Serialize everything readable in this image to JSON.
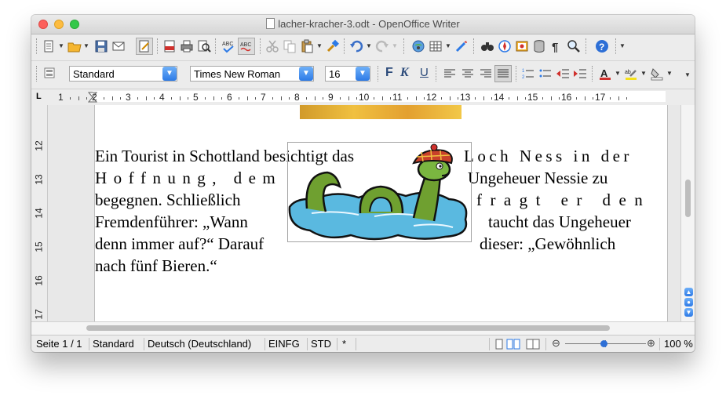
{
  "window": {
    "title": "lacher-kracher-3.odt - OpenOffice Writer"
  },
  "formatting": {
    "paragraph_style": "Standard",
    "font_name": "Times New Roman",
    "font_size": "16",
    "bold_label": "F",
    "italic_label": "K",
    "underline_label": "U"
  },
  "ruler": {
    "horizontal_numbers": [
      "1",
      "2",
      "3",
      "4",
      "5",
      "6",
      "7",
      "8",
      "9",
      "10",
      "11",
      "12",
      "13",
      "14",
      "15",
      "16",
      "17"
    ],
    "vertical_numbers": [
      "12",
      "13",
      "14",
      "15",
      "16",
      "17"
    ]
  },
  "document": {
    "lines": [
      "Ein Tourist in Schottland besichtigt das",
      "Loch Ness in der",
      "H o f f n u n g ,   d e m",
      "Ungeheuer Nessie zu",
      "begegnen. Schließlich",
      "f r a g t   e r   d e n",
      "Fremdenführer: „Wann",
      "taucht das Ungeheuer",
      "denn immer auf?“ Darauf",
      "dieser: „Gewöhnlich",
      "nach fünf Bieren.“"
    ]
  },
  "statusbar": {
    "page": "Seite 1 / 1",
    "style": "Standard",
    "language": "Deutsch (Deutschland)",
    "insert_mode": "EINFG",
    "selection_mode": "STD",
    "modified": "*",
    "zoom": "100 %"
  },
  "colors": {
    "traffic_red": "#fc605c",
    "traffic_yellow": "#fdbc40",
    "traffic_green": "#34c84a",
    "combo_arrow": "#2d7ae6"
  }
}
